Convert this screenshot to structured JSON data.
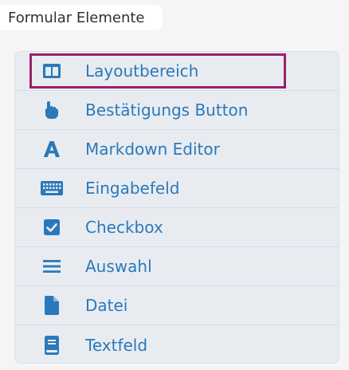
{
  "panel": {
    "title": "Formular Elemente"
  },
  "colors": {
    "accent": "#2a79ba",
    "selection_outline": "#9c1f6b",
    "list_background": "#e8ecf1"
  },
  "elements": [
    {
      "label": "Layoutbereich",
      "icon": "layout-columns-icon",
      "selected": true
    },
    {
      "label": "Bestätigungs Button",
      "icon": "pointer-hand-icon",
      "selected": false
    },
    {
      "label": "Markdown Editor",
      "icon": "text-font-icon",
      "selected": false
    },
    {
      "label": "Eingabefeld",
      "icon": "keyboard-icon",
      "selected": false
    },
    {
      "label": "Checkbox",
      "icon": "checkbox-checked-icon",
      "selected": false
    },
    {
      "label": "Auswahl",
      "icon": "list-lines-icon",
      "selected": false
    },
    {
      "label": "Datei",
      "icon": "file-icon",
      "selected": false
    },
    {
      "label": "Textfeld",
      "icon": "book-icon",
      "selected": false
    }
  ]
}
